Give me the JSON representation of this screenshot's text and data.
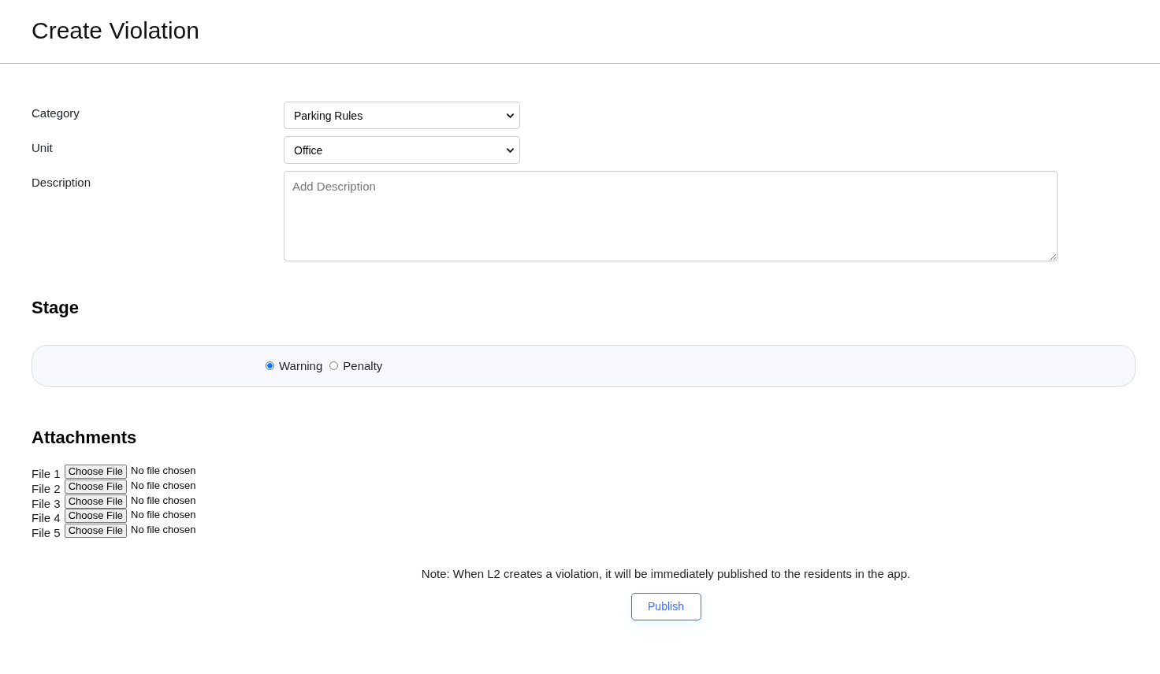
{
  "page_title": "Create Violation",
  "fields": [
    {
      "label": "Category",
      "kind": "select",
      "value": "Parking Rules"
    },
    {
      "label": "Unit",
      "kind": "select",
      "value": "Office"
    },
    {
      "label": "Description",
      "kind": "textarea",
      "placeholder": "Add Description"
    }
  ],
  "stage": {
    "heading": "Stage",
    "options": [
      {
        "label": "Warning",
        "selected": true
      },
      {
        "label": "Penalty",
        "selected": false
      }
    ]
  },
  "attachments": {
    "heading": "Attachments",
    "files": [
      {
        "label": "File 1",
        "button": "Choose File",
        "status": "No file chosen"
      },
      {
        "label": "File 2",
        "button": "Choose File",
        "status": "No file chosen"
      },
      {
        "label": "File 3",
        "button": "Choose File",
        "status": "No file chosen"
      },
      {
        "label": "File 4",
        "button": "Choose File",
        "status": "No file chosen"
      },
      {
        "label": "File 5",
        "button": "Choose File",
        "status": "No file chosen"
      }
    ]
  },
  "note": "Note: When L2 creates a violation, it will be immediately published to the residents in the app.",
  "publish_button": "Publish"
}
